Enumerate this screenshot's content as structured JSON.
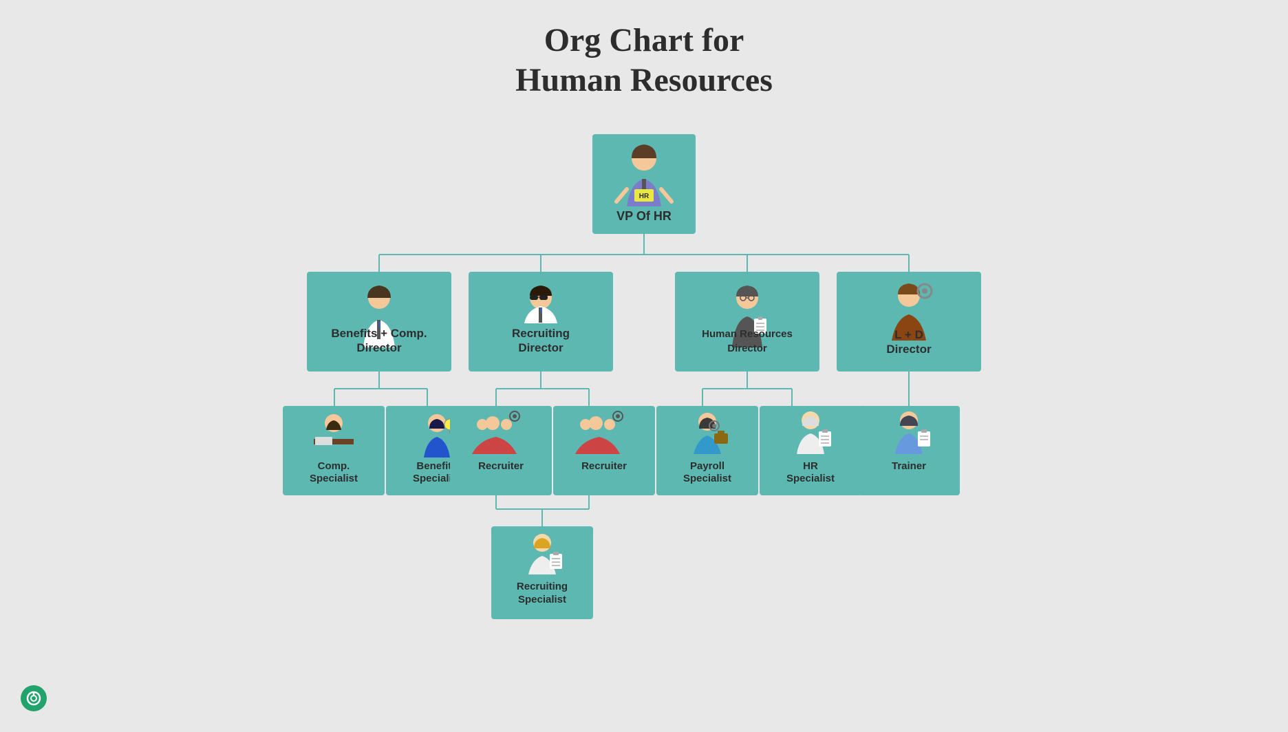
{
  "title": {
    "line1": "Org Chart for",
    "line2": "Human Resources"
  },
  "nodes": {
    "root": {
      "label": "VP Of HR",
      "iconType": "vp"
    },
    "level2": [
      {
        "id": "benefits-comp",
        "label": "Benefits + Comp. Director",
        "iconType": "benefits-comp"
      },
      {
        "id": "recruiting",
        "label": "Recruiting Director",
        "iconType": "recruiting"
      },
      {
        "id": "hr-director",
        "label": "Human Resources Director",
        "iconType": "hr-director"
      },
      {
        "id": "ld",
        "label": "L + D Director",
        "iconType": "ld"
      }
    ],
    "level3": {
      "benefits-comp": [
        {
          "id": "comp-spec",
          "label": "Comp. Specialist",
          "iconType": "comp-spec"
        },
        {
          "id": "benefits-spec",
          "label": "Benefits Specialist",
          "iconType": "benefits-spec"
        }
      ],
      "recruiting": [
        {
          "id": "recruiter1",
          "label": "Recruiter",
          "iconType": "recruiter"
        },
        {
          "id": "recruiter2",
          "label": "Recruiter",
          "iconType": "recruiter"
        }
      ],
      "hr-director": [
        {
          "id": "payroll-spec",
          "label": "Payroll Specialist",
          "iconType": "payroll-spec"
        },
        {
          "id": "hr-spec",
          "label": "HR Specialist",
          "iconType": "hr-spec"
        }
      ],
      "ld": [
        {
          "id": "trainer",
          "label": "Trainer",
          "iconType": "trainer"
        }
      ]
    },
    "level4": {
      "recruiting": [
        {
          "id": "recruiting-spec",
          "label": "Recruiting Specialist",
          "iconType": "recruiting-spec"
        }
      ]
    }
  },
  "colors": {
    "node_bg": "#5db8b2",
    "line": "#5db8b2",
    "text": "#2d2d2d",
    "bg": "#e8e8e8",
    "bottom_btn": "#22a36b"
  }
}
